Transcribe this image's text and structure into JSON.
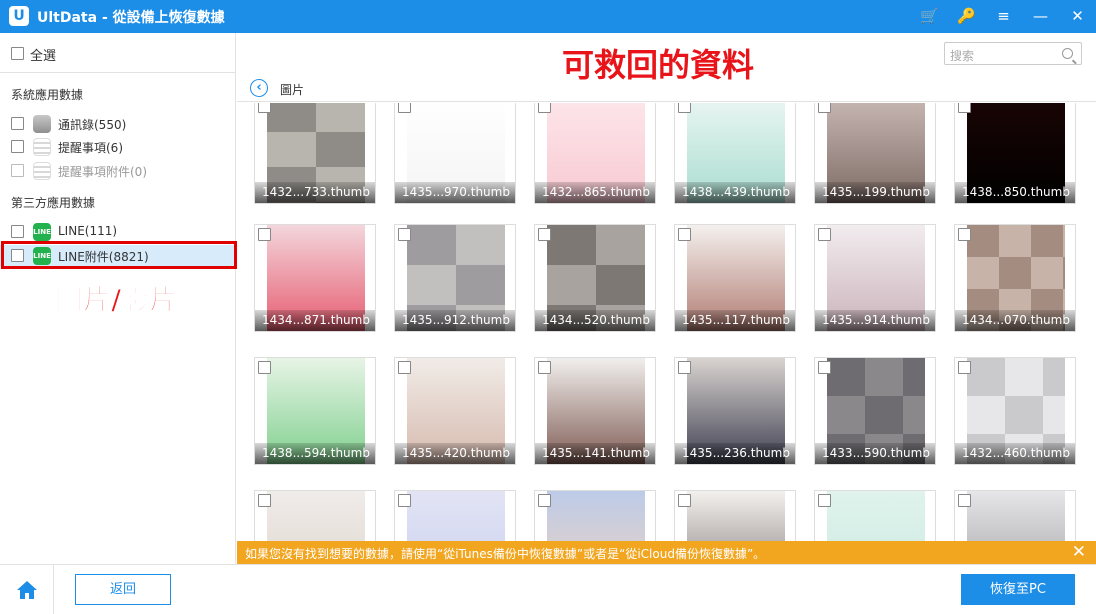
{
  "app": {
    "name": "UltData",
    "separator": "-",
    "title": "從設備上恢復數據"
  },
  "window_icons": [
    "cart-icon",
    "key-icon",
    "menu-icon",
    "minimize-icon",
    "close-icon"
  ],
  "sidebar": {
    "select_all": "全選",
    "section_system": "系統應用數據",
    "system_items": [
      {
        "label": "通訊錄(550)",
        "icon": "contacts-icon"
      },
      {
        "label": "提醒事項(6)",
        "icon": "reminder-icon"
      },
      {
        "label": "提醒事項附件(0)",
        "icon": "reminder-attachment-icon"
      }
    ],
    "section_third": "第三方應用數據",
    "third_items": [
      {
        "label": "LINE(111)",
        "icon": "line-icon"
      },
      {
        "label": "LINE附件(8821)",
        "icon": "line-icon"
      }
    ]
  },
  "annotations": {
    "left": "圖片/影片",
    "top": "可救回的資料"
  },
  "search": {
    "placeholder": "搜索"
  },
  "content": {
    "title": "圖片"
  },
  "thumbnails": [
    "1432...733.thumb",
    "1435...970.thumb",
    "1432...865.thumb",
    "1438...439.thumb",
    "1435...199.thumb",
    "1438...850.thumb",
    "1434...871.thumb",
    "1435...912.thumb",
    "1434...520.thumb",
    "1435...117.thumb",
    "1435...914.thumb",
    "1434...070.thumb",
    "1438...594.thumb",
    "1435...420.thumb",
    "1435...141.thumb",
    "1435...236.thumb",
    "1433...590.thumb",
    "1432...460.thumb",
    "",
    "",
    "",
    "",
    "",
    ""
  ],
  "notice": {
    "text": "如果您沒有找到想要的數據，請使用“從iTunes備份中恢復數據”或者是“從iCloud備份恢復數據”。"
  },
  "footer": {
    "back": "返回",
    "recover": "恢復至PC"
  },
  "colors": {
    "accent": "#1d8ee8",
    "notice": "#f2a51f",
    "highlight": "#e00000"
  }
}
